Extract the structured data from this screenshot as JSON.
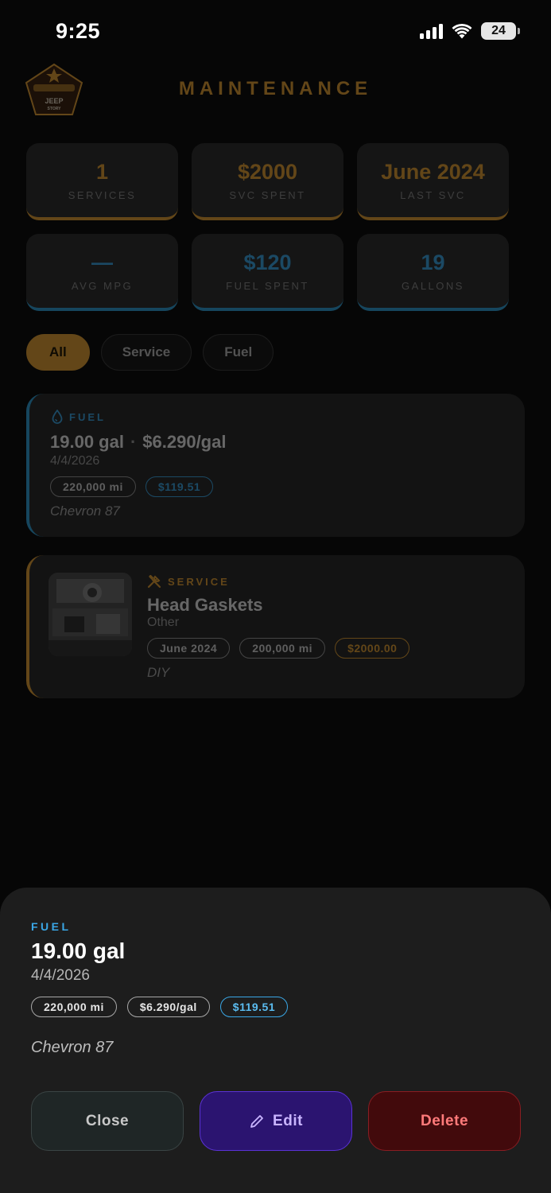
{
  "status_bar": {
    "time": "9:25",
    "battery": "24"
  },
  "header": {
    "title": "MAINTENANCE",
    "logo_text_1": "JEEP",
    "logo_text_2": "STORY"
  },
  "stats": [
    {
      "value": "1",
      "label": "SERVICES",
      "accent": "#e3a032"
    },
    {
      "value": "$2000",
      "label": "SVC SPENT",
      "accent": "#e3a032"
    },
    {
      "value": "June 2024",
      "label": "LAST SVC",
      "accent": "#e3a032"
    },
    {
      "value": "—",
      "label": "AVG MPG",
      "accent": "#2e9fd8"
    },
    {
      "value": "$120",
      "label": "FUEL SPENT",
      "accent": "#2e9fd8"
    },
    {
      "value": "19",
      "label": "GALLONS",
      "accent": "#2e9fd8"
    }
  ],
  "filters": {
    "all": "All",
    "service": "Service",
    "fuel": "Fuel",
    "selected": "All"
  },
  "entries": {
    "fuel": {
      "tag": "FUEL",
      "gallons": "19.00 gal",
      "price": "$6.290/gal",
      "date": "4/4/2026",
      "odometer": "220,000 mi",
      "total": "$119.51",
      "note": "Chevron 87"
    },
    "service": {
      "tag": "SERVICE",
      "title": "Head Gaskets",
      "category": "Other",
      "date": "June 2024",
      "odometer": "200,000 mi",
      "cost": "$2000.00",
      "note": "DIY"
    }
  },
  "sheet": {
    "tag": "FUEL",
    "title": "19.00 gal",
    "date": "4/4/2026",
    "odometer": "220,000 mi",
    "price": "$6.290/gal",
    "total": "$119.51",
    "note": "Chevron 87",
    "close_label": "Close",
    "edit_label": "Edit",
    "delete_label": "Delete"
  },
  "colors": {
    "gold": "#e3a032",
    "blue": "#3aa7e6",
    "edit": "#5b32d6",
    "delete": "#8a1d22"
  }
}
